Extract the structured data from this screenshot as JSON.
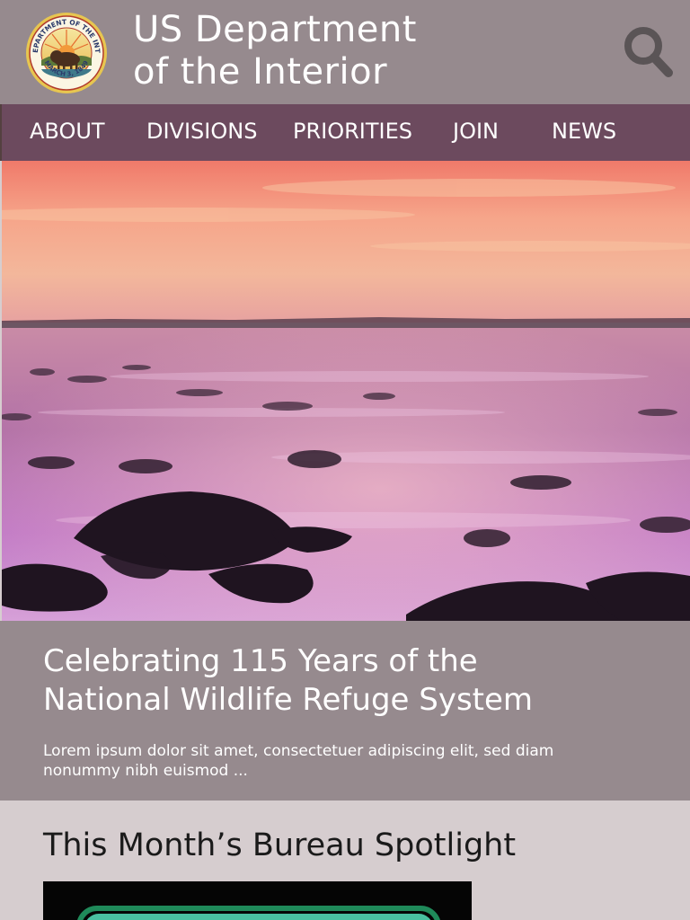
{
  "header": {
    "title_line1": "US Department",
    "title_line2": "of the Interior",
    "seal": {
      "top_text": "U.S. DEPARTMENT OF THE INTERIOR",
      "bottom_text": "MARCH 3, 1849"
    },
    "search_icon": "search-icon"
  },
  "nav": {
    "items": [
      {
        "label": "ABOUT"
      },
      {
        "label": "DIVISIONS"
      },
      {
        "label": "PRIORITIES"
      },
      {
        "label": "JOIN"
      },
      {
        "label": "NEWS"
      }
    ]
  },
  "feature": {
    "title_line1": "Celebrating 115 Years of the",
    "title_line2": "National Wildlife Refuge System",
    "description": "Lorem ipsum dolor sit amet, consectetuer adipiscing elit, sed diam nonummy nibh euismod ..."
  },
  "spotlight": {
    "title": "This Month’s Bureau Spotlight"
  },
  "colors": {
    "header_bg": "#968a8e",
    "nav_bg": "#6c4a5e",
    "page_bg": "#d6cdcf",
    "search_icon": "#5a5456"
  }
}
